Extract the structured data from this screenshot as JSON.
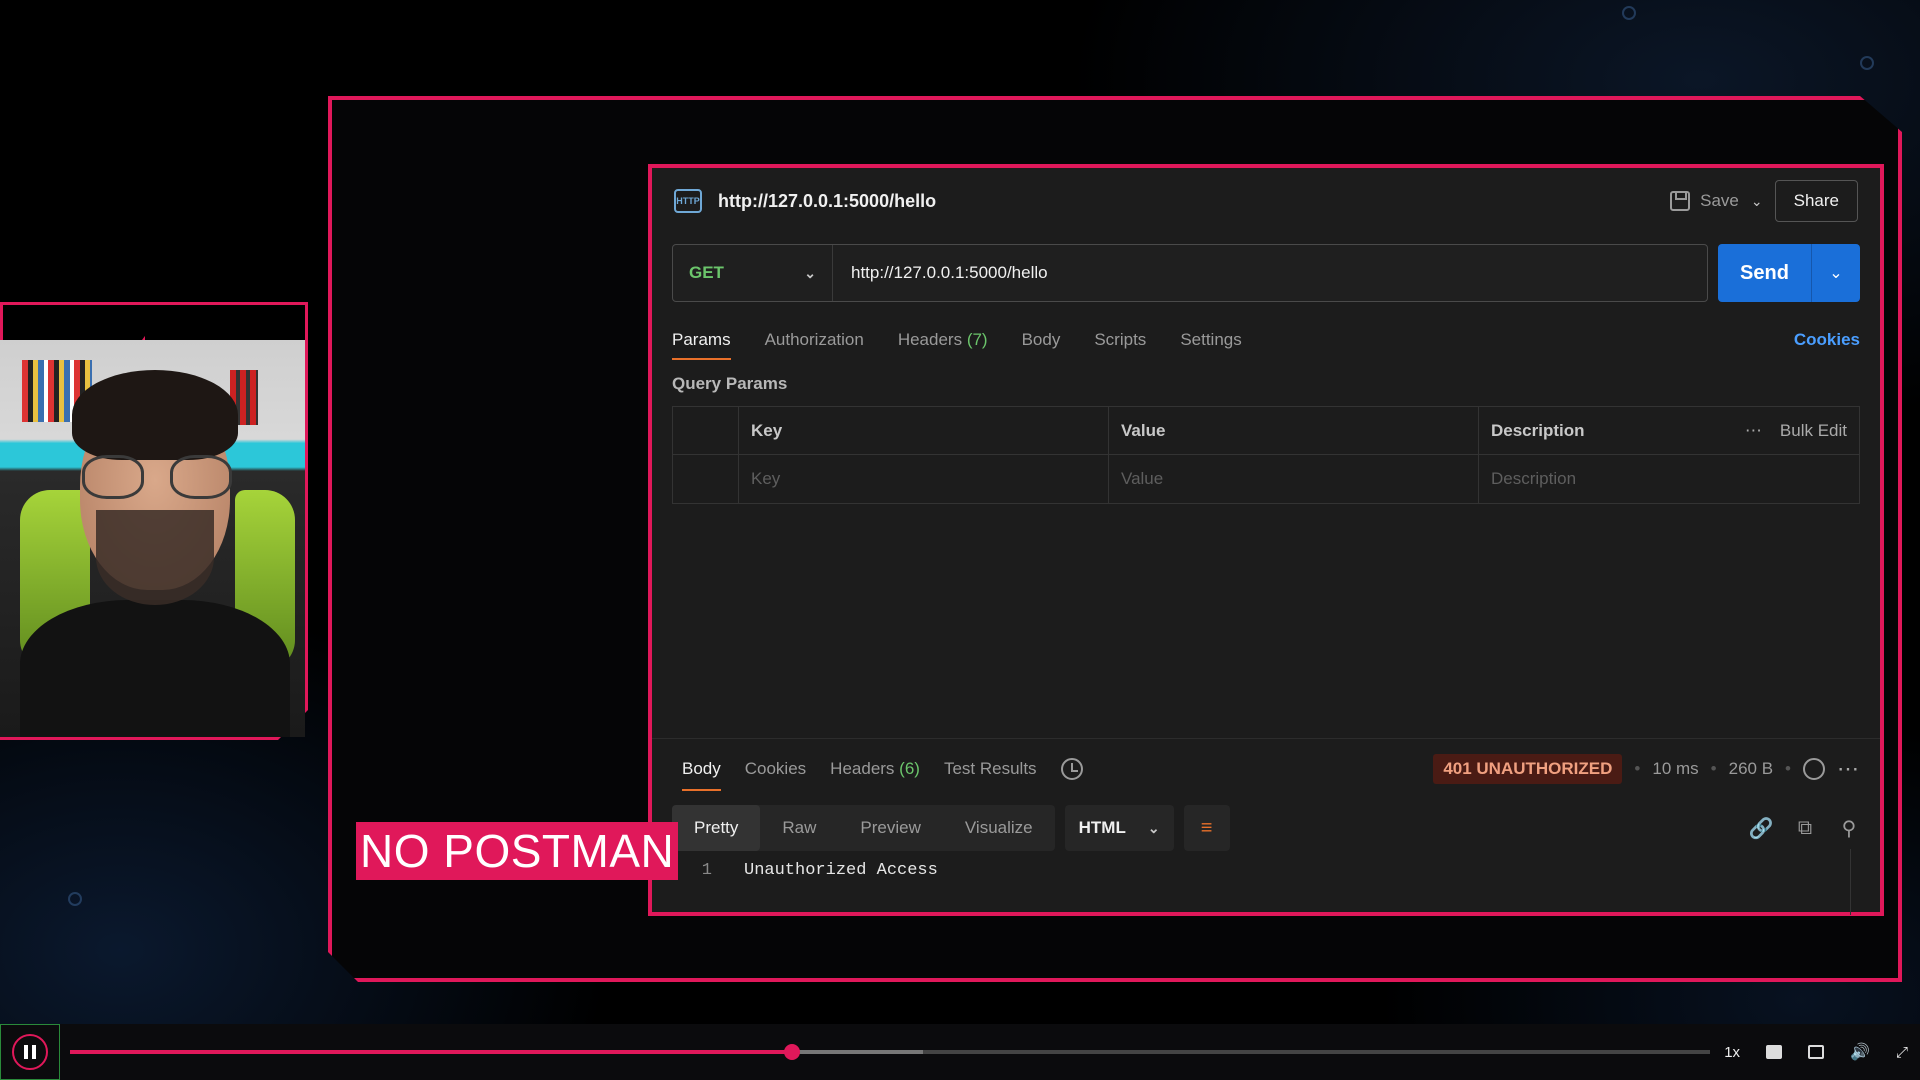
{
  "postman": {
    "title": "http://127.0.0.1:5000/hello",
    "http_icon_text": "HTTP",
    "save_label": "Save",
    "share_label": "Share",
    "method": "GET",
    "url": "http://127.0.0.1:5000/hello",
    "send_label": "Send",
    "request_tabs": [
      {
        "label": "Params"
      },
      {
        "label": "Authorization"
      },
      {
        "label": "Headers",
        "count": "(7)"
      },
      {
        "label": "Body"
      },
      {
        "label": "Scripts"
      },
      {
        "label": "Settings"
      }
    ],
    "cookies_label": "Cookies",
    "query_params_label": "Query Params",
    "table": {
      "headers": [
        "Key",
        "Value",
        "Description"
      ],
      "placeholders": [
        "Key",
        "Value",
        "Description"
      ],
      "bulk_edit_label": "Bulk Edit"
    },
    "response": {
      "tabs": [
        {
          "label": "Body"
        },
        {
          "label": "Cookies"
        },
        {
          "label": "Headers",
          "count": "(6)"
        },
        {
          "label": "Test Results"
        }
      ],
      "status": "401 UNAUTHORIZED",
      "time": "10 ms",
      "size": "260 B",
      "view_tabs": [
        "Pretty",
        "Raw",
        "Preview",
        "Visualize"
      ],
      "format": "HTML",
      "code_line_no": "1",
      "code_text": "Unauthorized Access"
    }
  },
  "overlay_text": "NO POSTMAN",
  "player": {
    "progress": 0.44,
    "buffered": 0.52,
    "speed": "1x"
  },
  "colors": {
    "accent_pink": "#e0185a",
    "send_blue": "#1a6fd9",
    "method_green": "#6bc56b",
    "tab_underline": "#e8702a"
  }
}
